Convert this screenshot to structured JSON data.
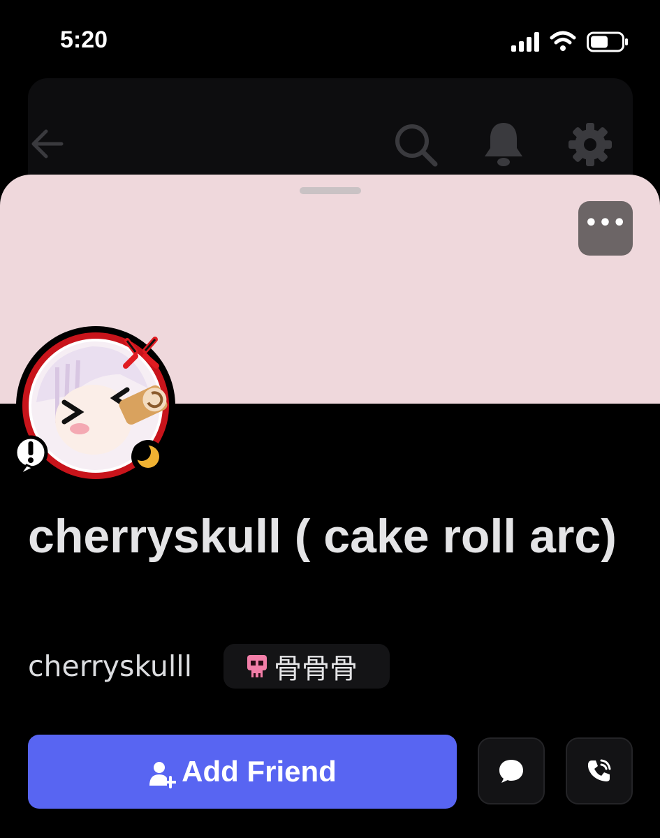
{
  "status_bar": {
    "time": "5:20",
    "signal_icon": "cellular-signal-icon",
    "wifi_icon": "wifi-icon",
    "battery_icon": "battery-icon"
  },
  "background_nav": {
    "icons": [
      "back-arrow-icon",
      "search-icon",
      "bell-icon",
      "gear-icon"
    ]
  },
  "profile": {
    "banner_color": "#efd8dc",
    "more_label": "•••",
    "display_name": "cherryskull ( cake roll arc)",
    "username": "cherryskulll",
    "clan_tag": "骨骨骨",
    "clan_icon": "pink-skull-icon",
    "status": "idle-moon-icon",
    "avatar_badge": "exclamation-bubble-icon"
  },
  "actions": {
    "add_friend_label": "Add Friend",
    "add_friend_icon": "add-user-icon",
    "message_icon": "chat-bubble-icon",
    "call_icon": "phone-call-icon",
    "accent_color": "#5865f2"
  }
}
